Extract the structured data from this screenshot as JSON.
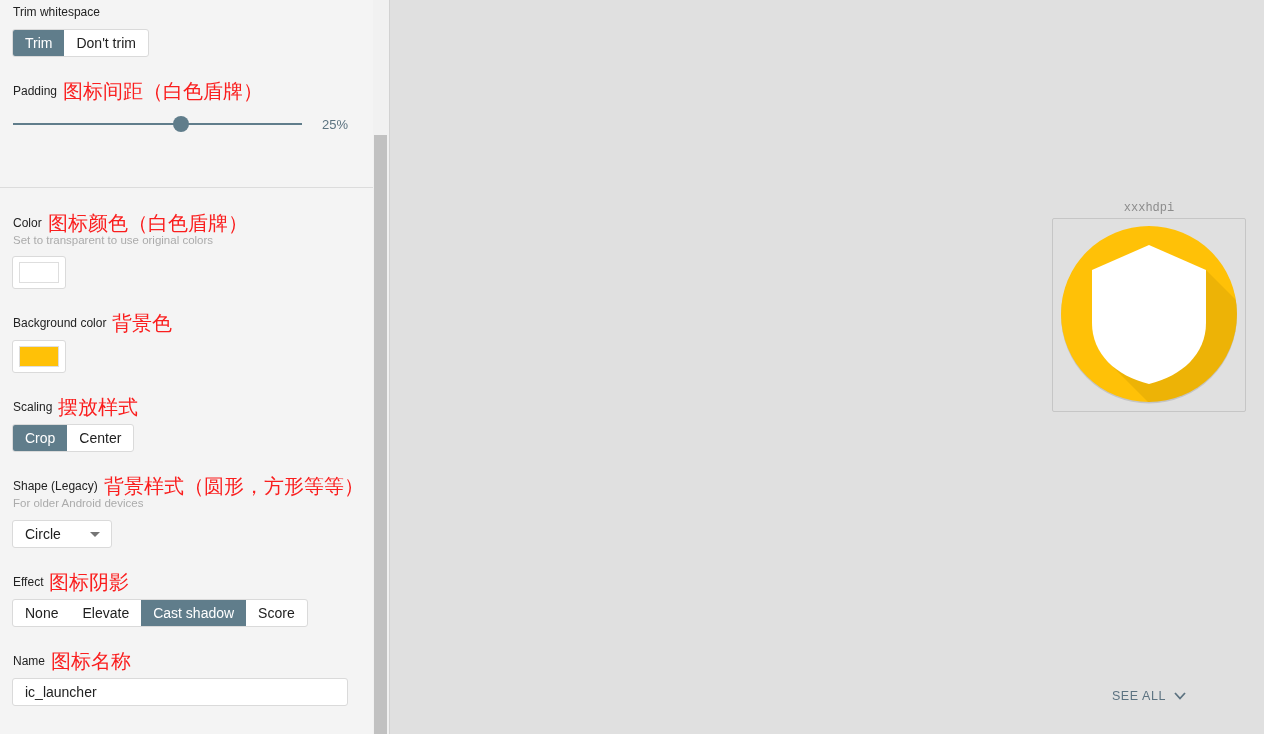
{
  "settings": {
    "groups": [
      {
        "fields": [
          {
            "kind": "segmented",
            "label": "Trim whitespace",
            "options": [
              {
                "label": "Trim",
                "selected": true
              },
              {
                "label": "Don't trim",
                "selected": false
              }
            ]
          },
          {
            "kind": "slider",
            "label": "Padding",
            "annotation": "图标间距（白色盾牌）",
            "level": 0.58,
            "reading": "25%"
          }
        ]
      },
      {
        "fields": [
          {
            "kind": "swatch",
            "label": "Color",
            "annotation": "图标颜色（白色盾牌）",
            "hint": "Set to transparent to use original colors",
            "color": "#ffffff"
          },
          {
            "kind": "swatch",
            "label": "Background color",
            "annotation": "背景色",
            "color": "#ffc107"
          },
          {
            "kind": "segmented",
            "label": "Scaling",
            "annotation": "摆放样式",
            "options": [
              {
                "label": "Crop",
                "selected": true
              },
              {
                "label": "Center",
                "selected": false
              }
            ]
          },
          {
            "kind": "dropdown",
            "label": "Shape (Legacy)",
            "annotation": "背景样式（圆形，方形等等）",
            "hint": "For older Android devices",
            "value": "Circle"
          },
          {
            "kind": "segmented",
            "label": "Effect",
            "annotation": "图标阴影",
            "options": [
              {
                "label": "None",
                "selected": false
              },
              {
                "label": "Elevate",
                "selected": false
              },
              {
                "label": "Cast shadow",
                "selected": true
              },
              {
                "label": "Score",
                "selected": false
              }
            ]
          },
          {
            "kind": "text",
            "label": "Name",
            "annotation": "图标名称",
            "value": "ic_launcher"
          }
        ]
      }
    ]
  },
  "preview": {
    "density": "xxxhdpi",
    "see_all": "SEE ALL"
  }
}
